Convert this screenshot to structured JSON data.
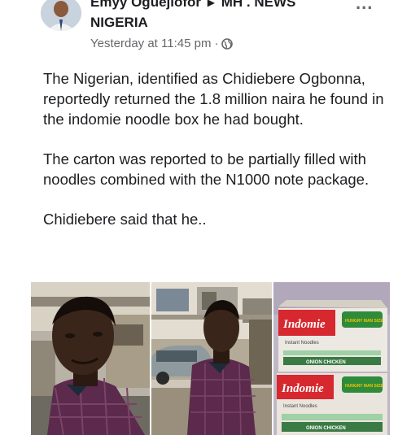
{
  "post": {
    "author": "Emyy Oguejiofor",
    "group_line1": "MH . NEWS",
    "group_line2": "NIGERIA",
    "timestamp": "Yesterday at 11:45 pm",
    "audience_icon": "globe-icon",
    "more_label": "...",
    "paragraphs": [
      "The Nigerian, identified as Chidiebere Ogbonna, reportedly returned the 1.8 million naira he found in the indomie noodle box he had bought.",
      "The carton was reported to be partially filled with noodles combined with the N1000 note package.",
      "Chidiebere said that he.."
    ]
  },
  "photos": {
    "box_brand": "Indomie",
    "box_badge": "HUNGRY MAN SIZE",
    "box_product": "Instant Noodles",
    "box_flavour": "ONION CHICKEN"
  },
  "colors": {
    "shirt": "#5b2a4c",
    "box_red": "#d7282f",
    "badge_green": "#2e8b3a",
    "badge_yellow": "#f5c400"
  }
}
